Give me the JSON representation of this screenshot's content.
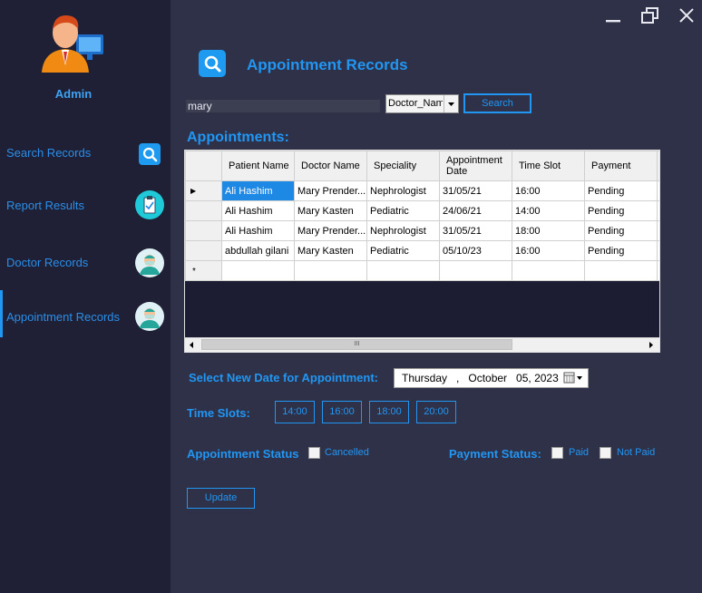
{
  "window": {
    "minimize_icon": "minimize-icon",
    "restore_icon": "restore-icon",
    "close_icon": "close-icon"
  },
  "sidebar": {
    "user_label": "Admin",
    "items": [
      {
        "label": "Search Records",
        "icon": "search-icon"
      },
      {
        "label": "Report Results",
        "icon": "clipboard-icon"
      },
      {
        "label": "Doctor Records",
        "icon": "doctor-icon"
      },
      {
        "label": "Appointment Records",
        "icon": "doctor-icon",
        "active": true
      }
    ]
  },
  "header": {
    "title": "Appointment Records",
    "icon": "search-icon"
  },
  "search": {
    "value": "mary",
    "field_select": "Doctor_Nam",
    "button_label": "Search"
  },
  "appointments": {
    "title": "Appointments:",
    "columns": [
      "Patient Name",
      "Doctor Name",
      "Speciality",
      "Appointment Date",
      "Time Slot",
      "Payment"
    ],
    "rows": [
      [
        "Ali  Hashim",
        "Mary Prender...",
        "Nephrologist",
        "31/05/21",
        "16:00",
        "Pending"
      ],
      [
        "Ali  Hashim",
        "Mary Kasten",
        "Pediatric",
        "24/06/21",
        "14:00",
        "Pending"
      ],
      [
        "Ali  Hashim",
        "Mary Prender...",
        "Nephrologist",
        "31/05/21",
        "18:00",
        "Pending"
      ],
      [
        "abdullah gilani",
        "Mary Kasten",
        "Pediatric",
        "05/10/23",
        "16:00",
        "Pending"
      ]
    ],
    "current_row_marker": "▶",
    "new_row_marker": "*",
    "scroll_grip": "III"
  },
  "form": {
    "date_label": "Select New Date for Appointment:",
    "date_value": "Thursday   ,   October   05, 2023",
    "time_slots_label": "Time Slots:",
    "time_slots": [
      "14:00",
      "16:00",
      "18:00",
      "20:00"
    ],
    "status_label": "Appointment Status",
    "cancelled_label": "Cancelled",
    "payment_label": "Payment Status:",
    "paid_label": "Paid",
    "not_paid_label": "Not Paid",
    "update_label": "Update"
  },
  "colors": {
    "accent": "#2196f3",
    "sidebar_bg": "#1f2035",
    "main_bg": "#2e3148",
    "selection": "#1e88e5"
  }
}
